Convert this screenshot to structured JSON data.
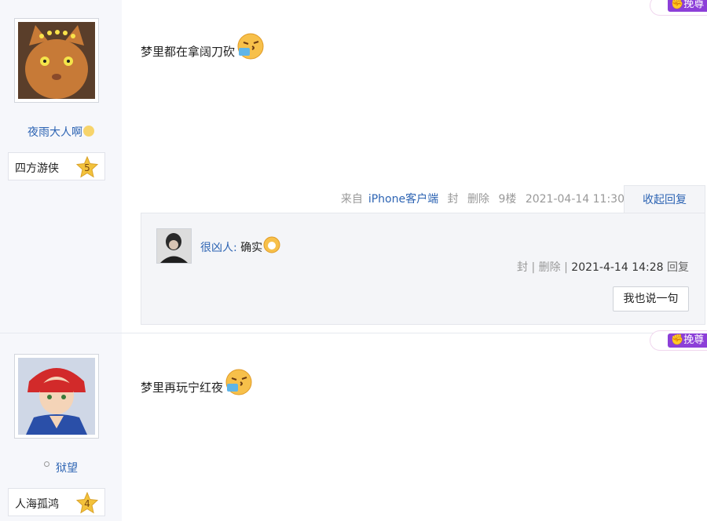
{
  "posts": [
    {
      "username": "夜雨大人啊",
      "level_title": "四方游侠",
      "level_num": "5",
      "content": "梦里都在拿阔刀砍",
      "tag_label": "挽尊",
      "meta": {
        "client_prefix": "来自",
        "client": "iPhone客户端",
        "ban": "封",
        "delete": "删除",
        "floor": "9楼",
        "time": "2021-04-14 11:30"
      },
      "collapse_label": "收起回复",
      "reply": {
        "user": "很凶人:",
        "text": "确实",
        "ban": "封",
        "sep": "|",
        "delete": "删除",
        "time": "2021-4-14 14:28",
        "reply_label": "回复",
        "say_button": "我也说一句"
      }
    },
    {
      "username": "狱望",
      "level_title": "人海孤鸿",
      "level_num": "4",
      "content": "梦里再玩宁红夜",
      "tag_label": "挽尊"
    }
  ],
  "icons": {
    "emoji": "sneeze-emoji-icon",
    "level_star": "level-star-icon"
  },
  "colors": {
    "link": "#2d64b3",
    "sidebar_bg": "#f6f7fb",
    "tag_purple": "#8c3fd8",
    "star_gold": "#f3c23b"
  }
}
